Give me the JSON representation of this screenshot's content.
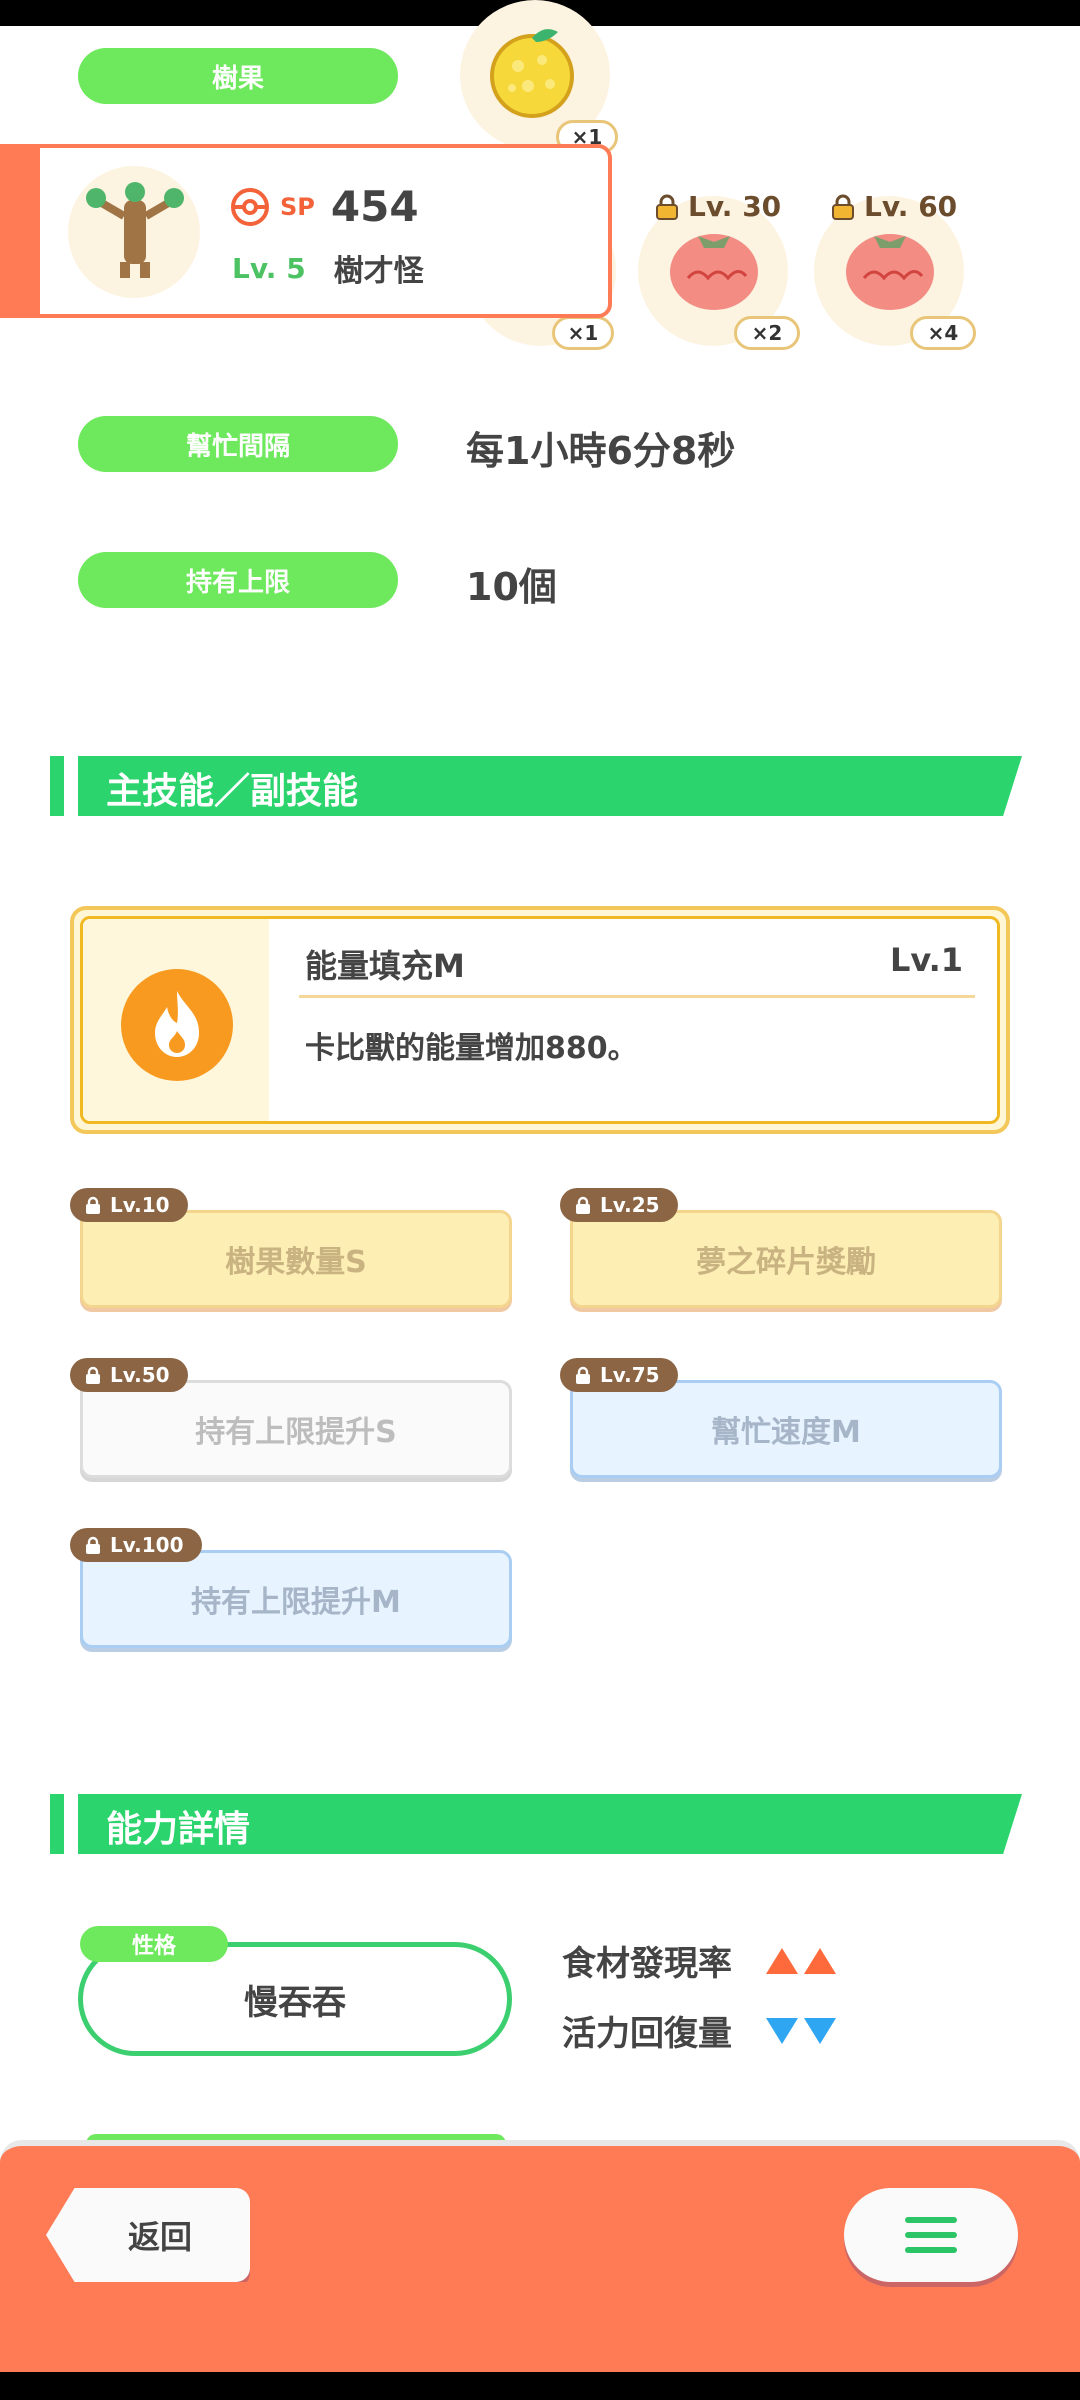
{
  "top_rows": {
    "berry": {
      "label": "樹果",
      "count": "×1"
    },
    "help_interval": {
      "label": "幫忙間隔",
      "value": "每1小時6分8秒"
    },
    "carry_limit": {
      "label": "持有上限",
      "value": "10個"
    }
  },
  "pokemon": {
    "sp_label": "SP",
    "sp_value": "454",
    "level": "Lv. 5",
    "name": "樹才怪"
  },
  "ingredients": [
    {
      "count": "×1",
      "lock_level": ""
    },
    {
      "count": "×2",
      "lock_level": "Lv. 30"
    },
    {
      "count": "×4",
      "lock_level": "Lv. 60"
    }
  ],
  "skills_section": {
    "title": "主技能／副技能",
    "main_skill": {
      "name": "能量填充M",
      "level": "Lv.1",
      "description": "卡比獸的能量增加880。"
    },
    "sub_skills": [
      {
        "lock_level": "Lv.10",
        "name": "樹果數量S",
        "color": "yellow"
      },
      {
        "lock_level": "Lv.25",
        "name": "夢之碎片獎勵",
        "color": "yellow"
      },
      {
        "lock_level": "Lv.50",
        "name": "持有上限提升S",
        "color": "white"
      },
      {
        "lock_level": "Lv.75",
        "name": "幫忙速度M",
        "color": "blue"
      },
      {
        "lock_level": "Lv.100",
        "name": "持有上限提升M",
        "color": "blue"
      }
    ]
  },
  "ability_section": {
    "title": "能力詳情",
    "nature_tag": "性格",
    "nature": "慢吞吞",
    "effects": [
      {
        "label": "食材發現率",
        "direction": "up",
        "color": "#ff6a3d"
      },
      {
        "label": "活力回復量",
        "direction": "down",
        "color": "#2fa6f2"
      }
    ]
  },
  "bottom_bar": {
    "back_label": "返回",
    "menu_icon": "hamburger-menu-icon"
  },
  "colors": {
    "accent_green": "#2bd46d",
    "pill_green": "#6ee85c",
    "accent_orange": "#ff7b56",
    "gold": "#f0b921"
  }
}
